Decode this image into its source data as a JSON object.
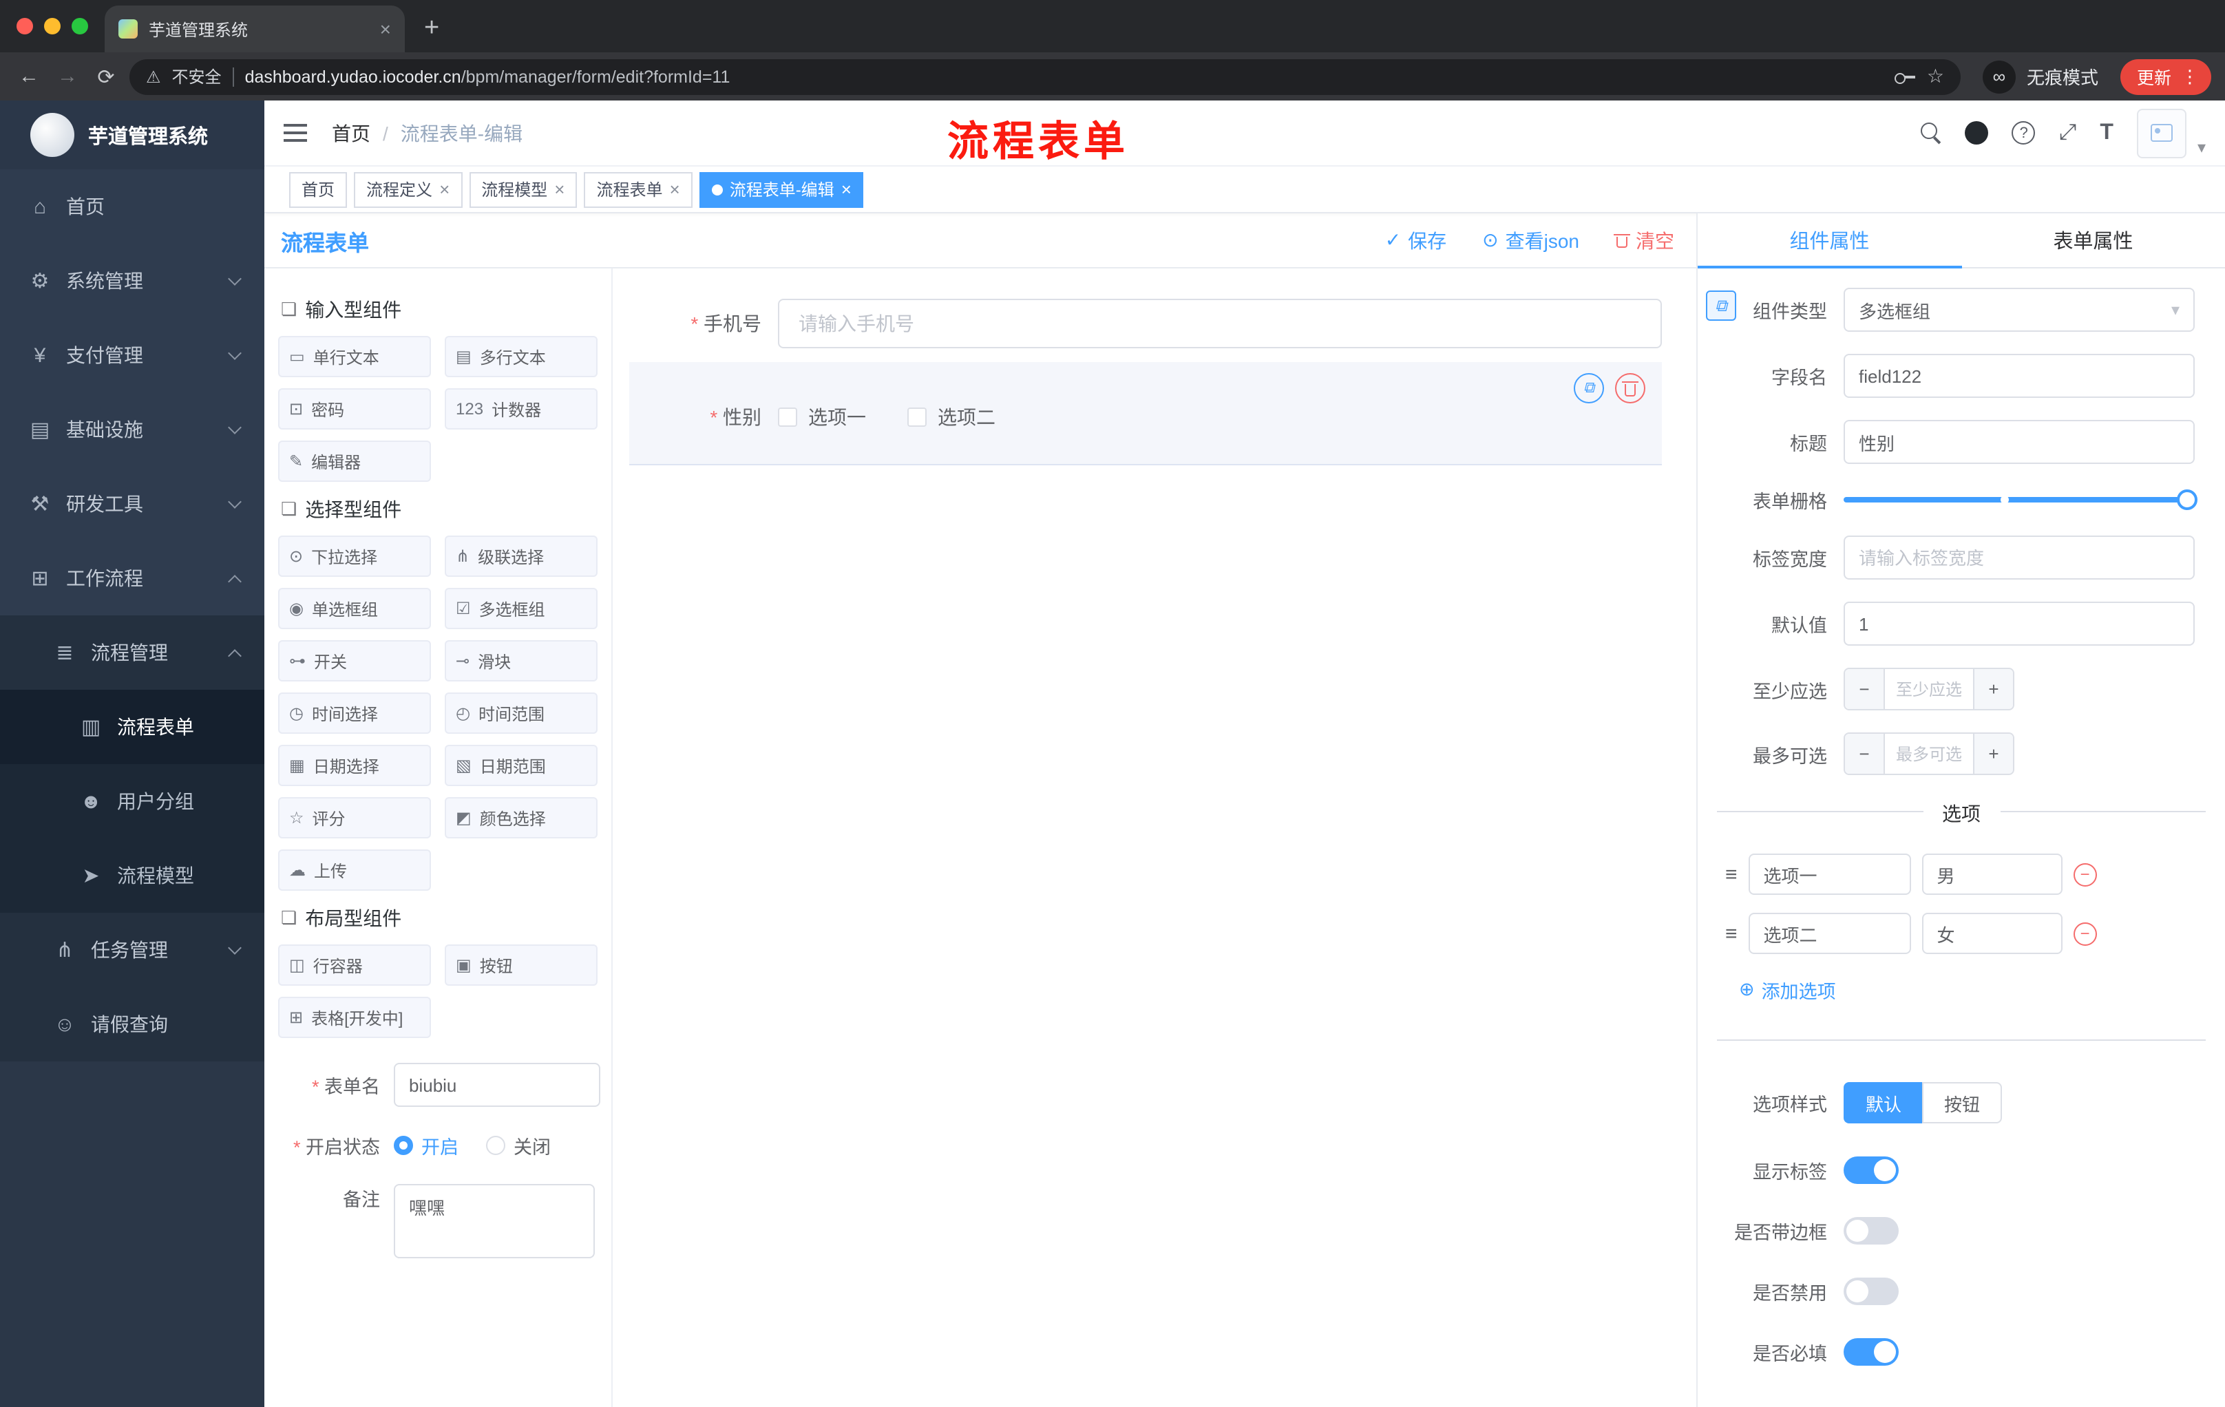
{
  "colors": {
    "accent": "#409eff",
    "danger": "#f56c6c",
    "annotation_red": "#fb1b10",
    "sidebar_bg": "#2f3c4f",
    "update_pill": "#e8453c"
  },
  "icons": {
    "close": "×",
    "plus": "+",
    "back": "←",
    "forward": "→",
    "reload": "⟳",
    "warning": "⚠",
    "star": "☆",
    "glasses": "∞",
    "kebab": "⋮",
    "caret": "▾",
    "question": "?",
    "fullscreen": "⤢",
    "font_size": "T",
    "check": "✓",
    "eye": "⊙",
    "copy": "⧉",
    "link": "⧉",
    "drag": "≡",
    "minus": "−",
    "circle_plus": "⊕",
    "group": "❏"
  },
  "browser": {
    "tab_title": "芋道管理系统",
    "security": "不安全",
    "url_domain": "dashboard.yudao.iocoder.cn",
    "url_path": "/bpm/manager/form/edit?formId=11",
    "incognito": "无痕模式",
    "update": "更新"
  },
  "sidebar": {
    "logo": "芋道管理系统",
    "menu": [
      {
        "label": "首页",
        "glyph": "⌂"
      },
      {
        "label": "系统管理",
        "glyph": "⚙"
      },
      {
        "label": "支付管理",
        "glyph": "¥"
      },
      {
        "label": "基础设施",
        "glyph": "▤"
      },
      {
        "label": "研发工具",
        "glyph": "⚒"
      },
      {
        "label": "工作流程",
        "glyph": "⊞"
      }
    ],
    "process_mgmt": {
      "label": "流程管理",
      "glyph": "≣"
    },
    "process_children": [
      {
        "label": "流程表单",
        "glyph": "▥"
      },
      {
        "label": "用户分组",
        "glyph": "☻"
      },
      {
        "label": "流程模型",
        "glyph": "➤"
      }
    ],
    "task_mgmt": {
      "label": "任务管理",
      "glyph": "⋔"
    },
    "leave_query": {
      "label": "请假查询",
      "glyph": "☺"
    }
  },
  "navbar": {
    "breadcrumb_home": "首页",
    "breadcrumb_separator": "/",
    "breadcrumb_current": "流程表单-编辑",
    "annotation": "流程表单"
  },
  "tags": [
    {
      "label": "首页"
    },
    {
      "label": "流程定义"
    },
    {
      "label": "流程模型"
    },
    {
      "label": "流程表单"
    },
    {
      "label": "流程表单-编辑"
    }
  ],
  "designer": {
    "title": "流程表单",
    "actions": {
      "save": "保存",
      "view_json": "查看json",
      "clear": "清空"
    },
    "palette": [
      {
        "title": "输入型组件",
        "items": [
          {
            "label": "单行文本",
            "glyph": "▭"
          },
          {
            "label": "多行文本",
            "glyph": "▤"
          },
          {
            "label": "密码",
            "glyph": "⊡"
          },
          {
            "label": "计数器",
            "glyph": "123"
          },
          {
            "label": "编辑器",
            "glyph": "✎"
          }
        ]
      },
      {
        "title": "选择型组件",
        "items": [
          {
            "label": "下拉选择",
            "glyph": "⊙"
          },
          {
            "label": "级联选择",
            "glyph": "⋔"
          },
          {
            "label": "单选框组",
            "glyph": "◉"
          },
          {
            "label": "多选框组",
            "glyph": "☑"
          },
          {
            "label": "开关",
            "glyph": "⊶"
          },
          {
            "label": "滑块",
            "glyph": "⊸"
          },
          {
            "label": "时间选择",
            "glyph": "◷"
          },
          {
            "label": "时间范围",
            "glyph": "◴"
          },
          {
            "label": "日期选择",
            "glyph": "▦"
          },
          {
            "label": "日期范围",
            "glyph": "▧"
          },
          {
            "label": "评分",
            "glyph": "☆"
          },
          {
            "label": "颜色选择",
            "glyph": "◩"
          },
          {
            "label": "上传",
            "glyph": "☁"
          }
        ]
      },
      {
        "title": "布局型组件",
        "items": [
          {
            "label": "行容器",
            "glyph": "◫"
          },
          {
            "label": "按钮",
            "glyph": "▣"
          },
          {
            "label": "表格[开发中]",
            "glyph": "⊞"
          }
        ]
      }
    ],
    "meta": {
      "form_name_label": "表单名",
      "form_name_value": "biubiu",
      "status_label": "开启状态",
      "status_on": "开启",
      "status_off": "关闭",
      "remark_label": "备注",
      "remark_value": "嘿嘿"
    }
  },
  "canvas": {
    "phone": {
      "label": "手机号",
      "placeholder": "请输入手机号"
    },
    "gender": {
      "label": "性别",
      "option1": "选项一",
      "option2": "选项二"
    }
  },
  "panel": {
    "tab_component": "组件属性",
    "tab_form": "表单属性",
    "component_type_label": "组件类型",
    "component_type_value": "多选框组",
    "field_name_label": "字段名",
    "field_name_value": "field122",
    "title_label": "标题",
    "title_value": "性别",
    "grid_label": "表单栅格",
    "label_width_label": "标签宽度",
    "label_width_placeholder": "请输入标签宽度",
    "default_label": "默认值",
    "default_value": "1",
    "min_label": "至少应选",
    "min_placeholder": "至少应选",
    "max_label": "最多可选",
    "max_placeholder": "最多可选",
    "options_title": "选项",
    "options": [
      {
        "label": "选项一",
        "value": "男"
      },
      {
        "label": "选项二",
        "value": "女"
      }
    ],
    "add_option": "添加选项",
    "style_label": "选项样式",
    "style_default": "默认",
    "style_button": "按钮",
    "show_label": {
      "label": "显示标签",
      "on": true
    },
    "border": {
      "label": "是否带边框",
      "on": false
    },
    "disabled": {
      "label": "是否禁用",
      "on": false
    },
    "required": {
      "label": "是否必填",
      "on": true
    }
  }
}
